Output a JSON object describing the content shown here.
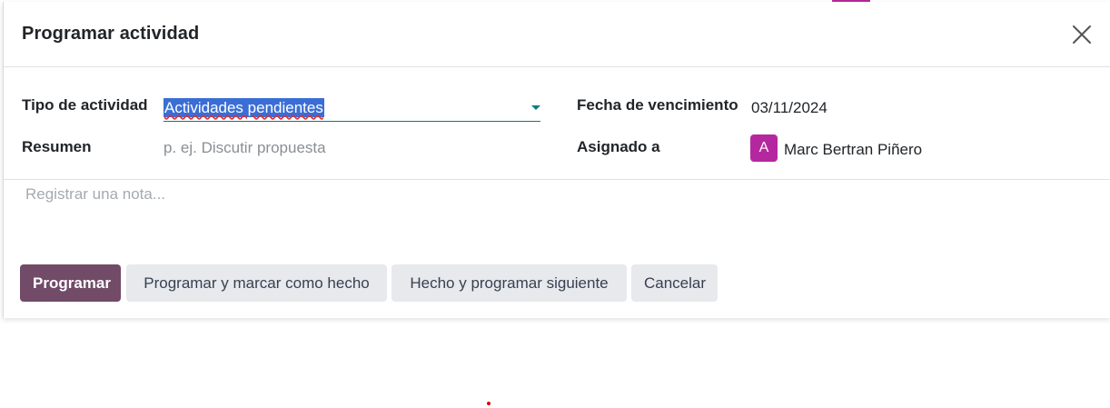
{
  "modal": {
    "title": "Programar actividad",
    "close_icon": "close-icon"
  },
  "form": {
    "activity_type_label": "Tipo de actividad",
    "activity_type_value": "Actividades pendientes",
    "summary_label": "Resumen",
    "summary_placeholder": "p. ej. Discutir propuesta",
    "due_date_label": "Fecha de vencimiento",
    "due_date_value": "03/11/2024",
    "assigned_label": "Asignado a",
    "assigned_initial": "A",
    "assigned_name": "Marc Bertran Piñero",
    "note_placeholder": "Registrar una nota..."
  },
  "footer": {
    "schedule_label": "Programar",
    "schedule_done_label": "Programar y marcar como hecho",
    "done_next_label": "Hecho y programar siguiente",
    "cancel_label": "Cancelar"
  },
  "colors": {
    "primary": "#714b67",
    "accent": "#017e84",
    "avatar": "#b5279e",
    "selection": "#3a6ed6"
  }
}
